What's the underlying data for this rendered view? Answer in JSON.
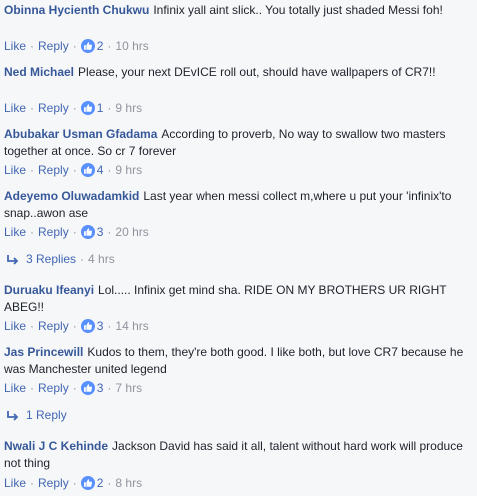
{
  "comments": [
    {
      "author": "Obinna Hycienth Chukwu",
      "text": "Infinix yall aint slick.. You totally just shaded Messi foh!",
      "like_label": "Like",
      "reply_label": "Reply",
      "reactions": "2",
      "time": "10 hrs"
    },
    {
      "author": "Ned Michael",
      "text": "Please, your next DEvICE roll out, should have wallpapers of CR7!!",
      "like_label": "Like",
      "reply_label": "Reply",
      "reactions": "1",
      "time": "9 hrs"
    },
    {
      "author": "Abubakar Usman Gfadama",
      "text": "According to proverb, No way to swallow two masters together at once. So cr 7 forever",
      "like_label": "Like",
      "reply_label": "Reply",
      "reactions": "4",
      "time": "9 hrs"
    },
    {
      "author": "Adeyemo Oluwadamkid",
      "text": "Last year when messi collect m,where u put your 'infinix'to snap..awon ase",
      "like_label": "Like",
      "reply_label": "Reply",
      "reactions": "3",
      "time": "20 hrs",
      "replies_label": "3 Replies",
      "replies_time": "4 hrs"
    },
    {
      "author": "Duruaku Ifeanyi",
      "text": "Lol..... Infinix get mind sha. RIDE ON MY BROTHERS UR RIGHT ABEG!!",
      "like_label": "Like",
      "reply_label": "Reply",
      "reactions": "3",
      "time": "14 hrs"
    },
    {
      "author": "Jas Princewill",
      "text": "Kudos to them, they're both good. I like both, but love CR7 because he was Manchester united legend",
      "like_label": "Like",
      "reply_label": "Reply",
      "reactions": "3",
      "time": "7 hrs",
      "replies_label": "1 Reply"
    },
    {
      "author": "Nwali J C Kehinde",
      "text": "Jackson David has said it all, talent without hard work will produce not thing",
      "like_label": "Like",
      "reply_label": "Reply",
      "reactions": "2",
      "time": "8 hrs"
    }
  ],
  "colors": {
    "author": "#365899",
    "link": "#4267b2",
    "meta": "#90949c",
    "like_badge": "#5890ff",
    "background": "#f6f7f9"
  },
  "icons": {
    "reaction": "thumbs-up-icon",
    "replies": "reply-arrow-icon"
  }
}
